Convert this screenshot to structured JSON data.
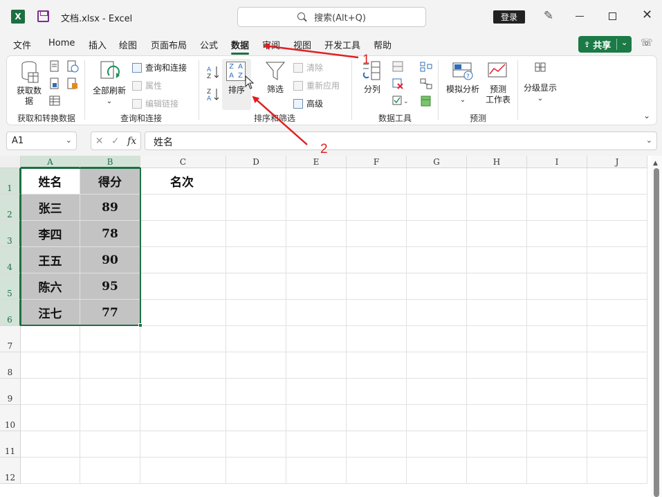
{
  "titlebar": {
    "logo": "X",
    "doc_title": "文档.xlsx  -  Excel",
    "search_placeholder": "搜索(Alt+Q)",
    "login_label": "登录",
    "icons": [
      "excel-icon",
      "save-icon",
      "search-icon",
      "pen-icon",
      "minimize-icon",
      "maximize-icon",
      "close-icon"
    ]
  },
  "menu": {
    "tabs": [
      "文件",
      "Home",
      "插入",
      "绘图",
      "页面布局",
      "公式",
      "数据",
      "审阅",
      "视图",
      "开发工具",
      "帮助"
    ],
    "active_tab": "数据",
    "share_label": "共享"
  },
  "ribbon": {
    "groups": {
      "get_transform": {
        "label": "获取和转换数据",
        "get_data_label": "获取数\n据"
      },
      "queries": {
        "label": "查询和连接",
        "refresh_all_label": "全部刷新",
        "queries_connections": "查询和连接",
        "properties": "属性",
        "edit_links": "编辑链接"
      },
      "sort_filter": {
        "label": "排序和筛选",
        "sort_label": "排序",
        "filter_label": "筛选",
        "clear": "清除",
        "reapply": "重新应用",
        "advanced": "高级",
        "sort_az_tiles": [
          "Z",
          "A",
          "A",
          "Z"
        ]
      },
      "data_tools": {
        "label": "数据工具",
        "text_to_columns_label": "分列"
      },
      "forecast": {
        "label": "预测",
        "what_if_label": "模拟分析",
        "forecast_sheet_label": "预测\n工作表"
      },
      "outline": {
        "outline_label": "分级显示"
      }
    }
  },
  "formula_bar": {
    "cell_ref": "A1",
    "formula": "姓名",
    "fx_label": "fx"
  },
  "sheet": {
    "columns": [
      "A",
      "B",
      "C",
      "D",
      "E",
      "F",
      "G",
      "H",
      "I",
      "J"
    ],
    "rows": [
      "1",
      "2",
      "3",
      "4",
      "5",
      "6",
      "7",
      "8",
      "9",
      "10",
      "11",
      "12"
    ],
    "cells": {
      "A1": "姓名",
      "B1": "得分",
      "C1": "名次",
      "A2": "张三",
      "B2": "89",
      "A3": "李四",
      "B3": "78",
      "A4": "王五",
      "B4": "90",
      "A5": "陈六",
      "B5": "95",
      "A6": "汪七",
      "B6": "77"
    }
  },
  "annotations": {
    "arrow1_label": "1",
    "arrow2_label": "2",
    "color": "#e02020"
  },
  "colors": {
    "accent": "#1d6f42",
    "selection_fill": "#c3c3c3"
  }
}
